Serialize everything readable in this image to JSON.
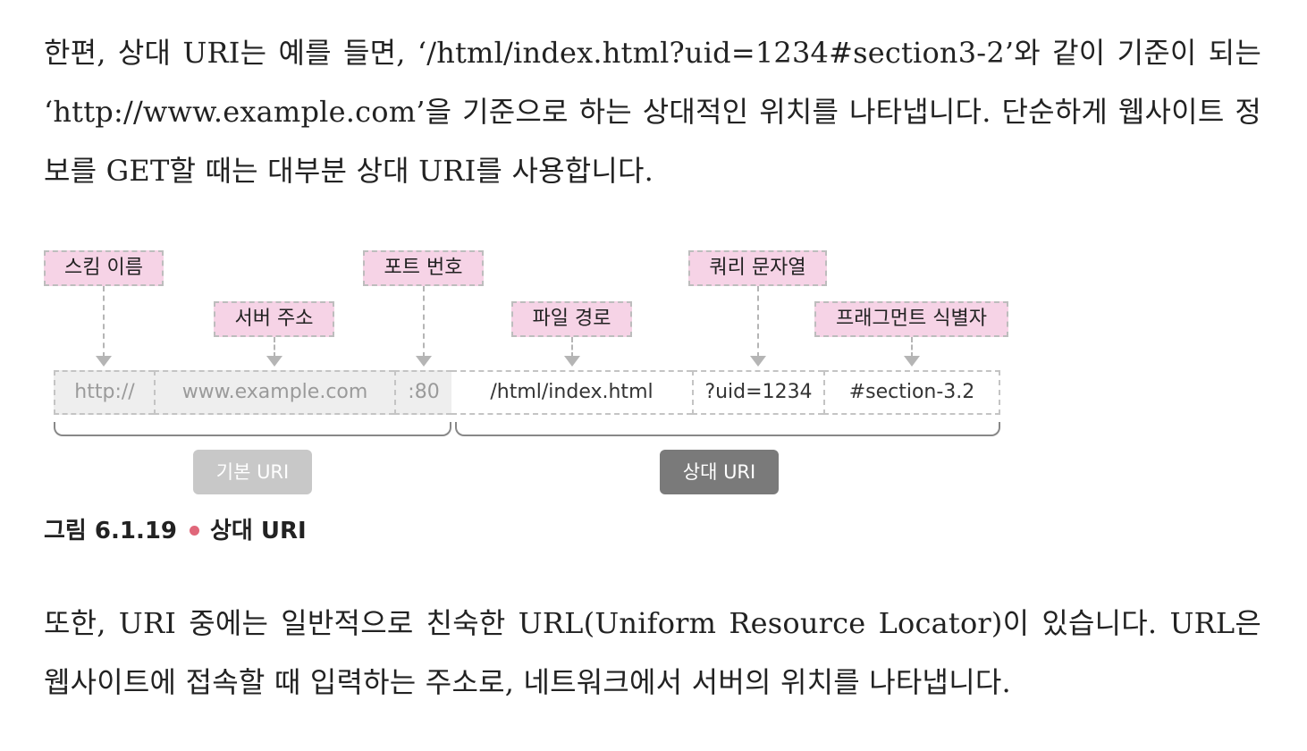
{
  "paragraph1": "한편, 상대 URI는 예를 들면, ‘/html/index.html?uid=1234#section3-2’와 같이 기준이 되는 ‘http://www.example.com’을 기준으로 하는 상대적인 위치를 나타냅니다. 단순하게 웹사이트 정보를 GET할 때는 대부분 상대 URI를 사용합니다.",
  "figure": {
    "labels": {
      "scheme": "스킴 이름",
      "server": "서버 주소",
      "port": "포트 번호",
      "file_path": "파일 경로",
      "query": "쿼리 문자열",
      "fragment": "프래그먼트 식별자"
    },
    "segments": {
      "scheme": "http://",
      "server": "www.example.com",
      "port": ":80",
      "file_path": "/html/index.html",
      "query": "?uid=1234",
      "fragment": "#section-3.2"
    },
    "groups": {
      "base": "기본 URI",
      "relative": "상대 URI"
    },
    "colors": {
      "label_fill": "#f6d3e6",
      "base_pill": "#c8c8c8",
      "relative_pill": "#7a7a7a",
      "caption_dot": "#e0677a"
    }
  },
  "caption": {
    "number": "그림 6.1.19",
    "title": "상대 URI"
  },
  "paragraph2": "또한, URI 중에는 일반적으로 친숙한 URL(Uniform Resource Locator)이 있습니다. URL은 웹사이트에 접속할 때 입력하는 주소로, 네트워크에서 서버의 위치를 나타냅니다."
}
